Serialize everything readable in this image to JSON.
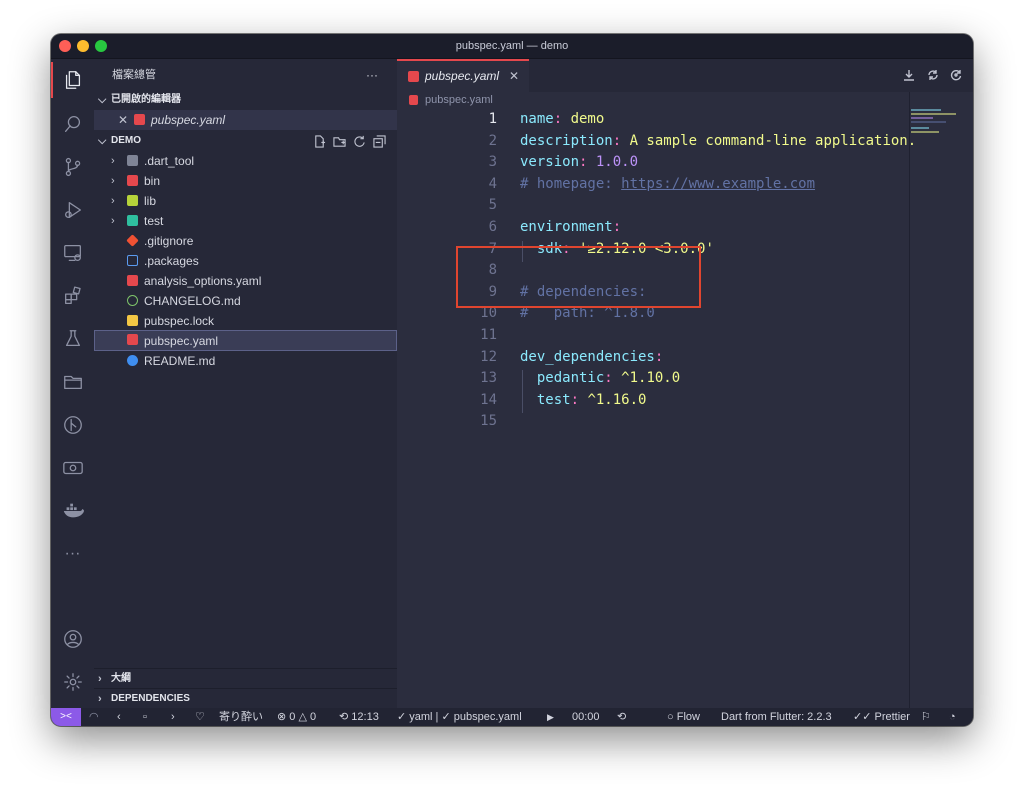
{
  "window": {
    "title": "pubspec.yaml — demo"
  },
  "sidebar": {
    "title": "檔案總管",
    "more": "···",
    "open_editors": {
      "header": "已開啟的編輯器",
      "file": "pubspec.yaml"
    },
    "folder": {
      "name": "DEMO",
      "items": [
        {
          "label": ".dart_tool",
          "kind": "folder"
        },
        {
          "label": "bin",
          "kind": "folder"
        },
        {
          "label": "lib",
          "kind": "folder"
        },
        {
          "label": "test",
          "kind": "folder"
        },
        {
          "label": ".gitignore",
          "kind": "file"
        },
        {
          "label": ".packages",
          "kind": "file"
        },
        {
          "label": "analysis_options.yaml",
          "kind": "file"
        },
        {
          "label": "CHANGELOG.md",
          "kind": "file"
        },
        {
          "label": "pubspec.lock",
          "kind": "file"
        },
        {
          "label": "pubspec.yaml",
          "kind": "file",
          "selected": true
        },
        {
          "label": "README.md",
          "kind": "file"
        }
      ]
    },
    "outline": "大綱",
    "dependencies": "DEPENDENCIES"
  },
  "editor": {
    "tab": "pubspec.yaml",
    "breadcrumb": "pubspec.yaml",
    "lines": [
      {
        "n": "1",
        "parts": [
          {
            "t": "name",
            "c": "key"
          },
          {
            "t": ": ",
            "c": "punc"
          },
          {
            "t": "demo",
            "c": "str"
          }
        ]
      },
      {
        "n": "2",
        "parts": [
          {
            "t": "description",
            "c": "key"
          },
          {
            "t": ": ",
            "c": "punc"
          },
          {
            "t": "A sample command-line application.",
            "c": "str"
          }
        ]
      },
      {
        "n": "3",
        "parts": [
          {
            "t": "version",
            "c": "key"
          },
          {
            "t": ": ",
            "c": "punc"
          },
          {
            "t": "1.0.0",
            "c": "num"
          }
        ]
      },
      {
        "n": "4",
        "parts": [
          {
            "t": "# homepage: ",
            "c": "cmt"
          },
          {
            "t": "https://www.example.com",
            "c": "link"
          }
        ]
      },
      {
        "n": "5",
        "parts": []
      },
      {
        "n": "6",
        "parts": [
          {
            "t": "environment",
            "c": "key"
          },
          {
            "t": ":",
            "c": "punc"
          }
        ]
      },
      {
        "n": "7",
        "parts": [
          {
            "t": "  ",
            "c": "punc"
          },
          {
            "t": "sdk",
            "c": "key"
          },
          {
            "t": ": ",
            "c": "punc"
          },
          {
            "t": "'≥2.12.0 <3.0.0'",
            "c": "str"
          }
        ]
      },
      {
        "n": "8",
        "parts": []
      },
      {
        "n": "9",
        "parts": [
          {
            "t": "# dependencies:",
            "c": "cmt"
          }
        ]
      },
      {
        "n": "10",
        "parts": [
          {
            "t": "#   path: ^1.8.0",
            "c": "cmt"
          }
        ]
      },
      {
        "n": "11",
        "parts": []
      },
      {
        "n": "12",
        "parts": [
          {
            "t": "dev_dependencies",
            "c": "key"
          },
          {
            "t": ":",
            "c": "punc"
          }
        ]
      },
      {
        "n": "13",
        "parts": [
          {
            "t": "  ",
            "c": "punc"
          },
          {
            "t": "pedantic",
            "c": "key"
          },
          {
            "t": ": ",
            "c": "punc"
          },
          {
            "t": "^1.10.0",
            "c": "str"
          }
        ]
      },
      {
        "n": "14",
        "parts": [
          {
            "t": "  ",
            "c": "punc"
          },
          {
            "t": "test",
            "c": "key"
          },
          {
            "t": ": ",
            "c": "punc"
          },
          {
            "t": "^1.16.0",
            "c": "str"
          }
        ]
      },
      {
        "n": "15",
        "parts": []
      }
    ]
  },
  "status": {
    "song": "寄り酔い",
    "errors": "0",
    "warnings": "0",
    "time": "12:13",
    "langs": "yaml | ",
    "file_check": "pubspec.yaml",
    "timer": "00:00",
    "flow": "Flow",
    "dart": "Dart from Flutter: 2.2.3",
    "prettier": "Prettier"
  },
  "colors": {
    "key": "#8be9fd",
    "str": "#f1fa8c",
    "num": "#bd93f9",
    "cmt": "#6272a4",
    "punc": "#ff79c6",
    "highlight_box": "#e0452f"
  }
}
